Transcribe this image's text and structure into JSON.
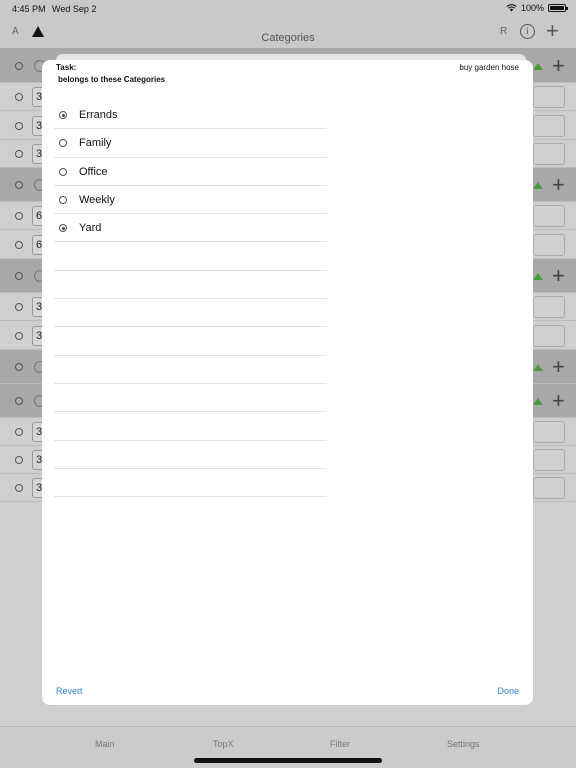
{
  "status_bar": {
    "time": "4:45 PM",
    "date": "Wed Sep 2",
    "battery": "100%",
    "battery_level": 1.0
  },
  "nav_bar": {
    "left_letter": "A",
    "title": "Categories",
    "right_letter": "R",
    "info_icon": "info-icon",
    "add_icon": "plus-icon"
  },
  "background_list": {
    "rows": [
      {
        "kind": "header",
        "num": ""
      },
      {
        "kind": "item",
        "num": "3"
      },
      {
        "kind": "item",
        "num": "3"
      },
      {
        "kind": "item",
        "num": "3"
      },
      {
        "kind": "header",
        "num": ""
      },
      {
        "kind": "item",
        "num": "6"
      },
      {
        "kind": "item",
        "num": "6"
      },
      {
        "kind": "header",
        "num": ""
      },
      {
        "kind": "item",
        "num": "3"
      },
      {
        "kind": "item",
        "num": "3"
      },
      {
        "kind": "header",
        "num": ""
      },
      {
        "kind": "header",
        "num": ""
      },
      {
        "kind": "item",
        "num": "3"
      },
      {
        "kind": "item",
        "num": "3"
      },
      {
        "kind": "item",
        "num": "3"
      }
    ]
  },
  "dialog": {
    "task_label": "Task:",
    "task_value": "buy garden hose",
    "belongs_label": "belongs to these Categories",
    "categories": [
      {
        "label": "Errands",
        "selected": true
      },
      {
        "label": "Family",
        "selected": false
      },
      {
        "label": "Office",
        "selected": false
      },
      {
        "label": "Weekly",
        "selected": false
      },
      {
        "label": "Yard",
        "selected": true
      }
    ],
    "empty_rows": 9,
    "revert_label": "Revert",
    "done_label": "Done"
  },
  "tab_bar": {
    "tabs": [
      "Main",
      "TopX",
      "Filter",
      "Settings"
    ]
  },
  "colors": {
    "accent": "#2f7fd6",
    "dim_background": "#cfcfcf",
    "header_row": "#a8a8a8",
    "triangle_green": "#4c9a3c"
  }
}
